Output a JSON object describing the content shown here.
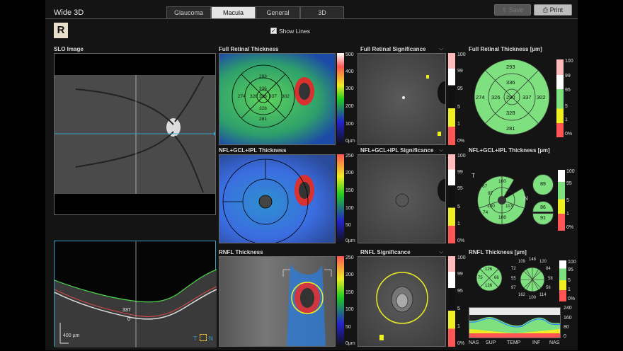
{
  "window": {
    "title": "Wide 3D"
  },
  "tabs": [
    {
      "label": "Glaucoma"
    },
    {
      "label": "Macula"
    },
    {
      "label": "General"
    },
    {
      "label": "3D"
    }
  ],
  "toolbar": {
    "save_label": "Save",
    "print_label": "Print"
  },
  "logo": {
    "letter": "R"
  },
  "show_lines": {
    "label": "Show Lines",
    "checked": true,
    "check": "✓"
  },
  "slo": {
    "label": "SLO Image"
  },
  "oct": {
    "value_337": "337",
    "value_0": "0",
    "scale_label": "400 µm",
    "t_label": "T",
    "n_label": "N"
  },
  "full_thickness": {
    "label": "Full Retinal Thickness",
    "scale": [
      "500",
      "400",
      "300",
      "200",
      "100",
      "0µm"
    ],
    "values": {
      "center": "326",
      "sup_in": "336",
      "inf_in": "328",
      "temp_in": "326",
      "nas_in": "337",
      "sup_out": "293",
      "inf_out": "281",
      "temp_out": "274",
      "nas_out": "302"
    }
  },
  "full_sig": {
    "label": "Full Retinal Significance",
    "scale": [
      "100",
      "99",
      "95",
      "5",
      "1",
      "0%"
    ]
  },
  "full_chart": {
    "label": "Full Retinal Thickness [µm]",
    "scale": [
      "100",
      "99",
      "95",
      "5",
      "1",
      "0%"
    ],
    "values": {
      "center": "290",
      "sup_in": "336",
      "inf_in": "328",
      "temp_in": "326",
      "nas_in": "337",
      "sup_out": "293",
      "inf_out": "281",
      "temp_out": "274",
      "nas_out": "302"
    }
  },
  "gcl_thickness": {
    "label": "NFL+GCL+IPL Thickness",
    "scale": [
      "250",
      "200",
      "150",
      "100",
      "50",
      "0µm"
    ]
  },
  "gcl_sig": {
    "label": "NFL+GCL+IPL Significance",
    "scale": [
      "100",
      "99",
      "95",
      "5",
      "1",
      "0%"
    ]
  },
  "gcl_chart": {
    "label": "NFL+GCL+IPL Thickness [µm]",
    "scale": [
      "100",
      "95",
      "5",
      "1",
      "0%"
    ],
    "sectors": {
      "top": "100",
      "upper_left": "67",
      "left_in": "97",
      "center_right": "115",
      "lower_mid": "113",
      "center_left": "100",
      "bottom": "108",
      "lower_left": "74"
    },
    "t_label": "T",
    "n_label": "N",
    "sup": "89",
    "mid": "86",
    "inf": "91"
  },
  "rnfl_thickness": {
    "label": "RNFL Thickness",
    "scale": [
      "250",
      "200",
      "150",
      "100",
      "50",
      "0µm"
    ]
  },
  "rnfl_sig": {
    "label": "RNFL Significance",
    "scale": [
      "100",
      "99",
      "95",
      "5",
      "1",
      "0%"
    ]
  },
  "rnfl_chart": {
    "label": "RNFL Thickness [µm]",
    "quadrants": {
      "sup": "126",
      "temp": "75",
      "nas": "66",
      "inf": "126"
    },
    "clock": {
      "c12": "148",
      "c1": "120",
      "c2": "84",
      "c3": "58",
      "c4": "56",
      "c5": "114",
      "c6": "100",
      "c7": "162",
      "c8": "97",
      "c9": "55",
      "c10": "72",
      "c11": "109",
      "n": "55"
    },
    "scale": [
      "100",
      "95",
      "5",
      "1",
      "0%"
    ],
    "profile_scale": [
      "240",
      "160",
      "80",
      "0"
    ],
    "profile_axis": [
      "NAS",
      "SUP",
      "TEMP",
      "INF",
      "NAS"
    ]
  },
  "colors": {
    "accent": "#3aa0c8",
    "normal": "#7ee07e",
    "border": "#8e8",
    "outside": "#ff5c5c",
    "yellow": "#f5f050"
  }
}
